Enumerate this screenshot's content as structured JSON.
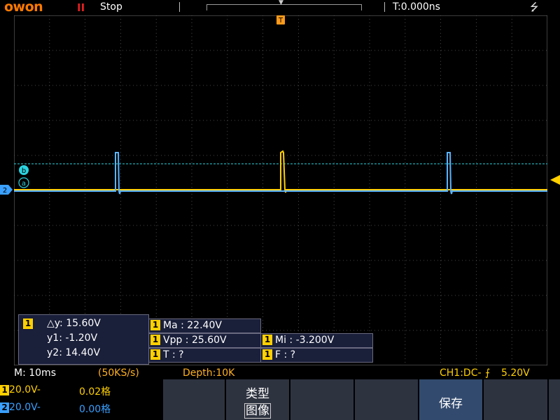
{
  "top": {
    "logo": "owon",
    "run_icon": "II",
    "run_state": "Stop",
    "trigger_delay": "T:0.000ns",
    "usb_icon": "⭍"
  },
  "markers": {
    "trigger_marker": "T",
    "cursor_b": "b",
    "cursor_a": "a",
    "ch2_marker": "2"
  },
  "cursor_readout": {
    "channel": "1",
    "dy": "△y: 15.60V",
    "y1": "y1: -1.20V",
    "y2": "y2: 14.40V"
  },
  "measurements": [
    {
      "channel": "1",
      "text": "Ma : 22.40V"
    },
    {
      "channel": "1",
      "text": "Vpp : 25.60V"
    },
    {
      "channel": "1",
      "text": "Mi : -3.200V"
    },
    {
      "channel": "1",
      "text": "T :    ?"
    },
    {
      "channel": "1",
      "text": "F :    ?"
    }
  ],
  "status": {
    "timebase": "M: 10ms",
    "sample_rate": "(50KS/s)",
    "depth": "Depth:10K",
    "trigger_info": "CH1:DC-",
    "trigger_level": "5.20V"
  },
  "channels": {
    "ch1": {
      "tag": "1",
      "scale": "20.0V-",
      "offset": "0.02格"
    },
    "ch2": {
      "tag": "2",
      "scale": "20.0V-",
      "offset": "0.00格"
    }
  },
  "softkeys": {
    "type_label": "类型",
    "type_value": "图像",
    "save_label": "保存"
  },
  "colors": {
    "ch1": "#ffd000",
    "ch2": "#3aa0ff",
    "cursor": "#2ad4e0",
    "grid": "#5a5a5a",
    "logo": "#ff7a00"
  }
}
